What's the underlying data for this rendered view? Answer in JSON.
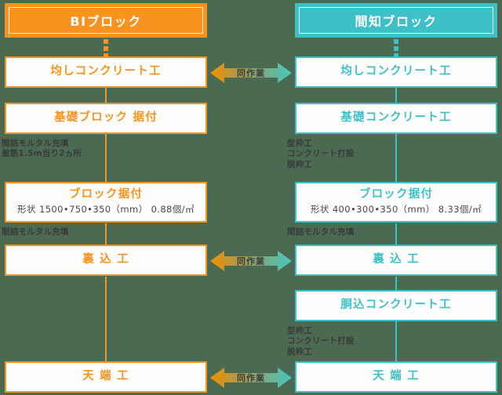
{
  "diagram": {
    "type": "process-flow-comparison",
    "background_color": "#4a6b52",
    "columns": [
      {
        "id": "left",
        "header": "BIブロック",
        "accent_color": "#f7931e"
      },
      {
        "id": "right",
        "header": "間知ブロック",
        "accent_color": "#3ec0c9"
      }
    ],
    "left_steps": [
      {
        "title": "均しコンクリート工",
        "sub": ""
      },
      {
        "title": "基礎ブロック 据付",
        "sub": ""
      },
      {
        "title": "ブロック据付",
        "sub": "形状 1500•750•350（mm） 0.88個/㎡"
      },
      {
        "title": "裏 込 工",
        "sub": ""
      },
      {
        "title": "天 端 工",
        "sub": ""
      }
    ],
    "right_steps": [
      {
        "title": "均しコンクリート工",
        "sub": ""
      },
      {
        "title": "基礎コンクリート工",
        "sub": ""
      },
      {
        "title": "ブロック据付",
        "sub": "形状 400•300•350（mm） 8.33個/㎡"
      },
      {
        "title": "裏 込 工",
        "sub": ""
      },
      {
        "title": "胴込コンクリート工",
        "sub": ""
      },
      {
        "title": "天 端 工",
        "sub": ""
      }
    ],
    "left_notes": [
      {
        "id": "left-note-1",
        "lines": [
          "間詰モルタル充填",
          "差筋1.5m当り2ヵ所"
        ]
      },
      {
        "id": "left-note-2",
        "lines": [
          "間詰モルタル充填"
        ]
      }
    ],
    "right_notes": [
      {
        "id": "right-note-1",
        "lines": [
          "型枠工",
          "コンクリート打設",
          "脱枠工"
        ]
      },
      {
        "id": "right-note-2",
        "lines": [
          "間詰モルタル充填"
        ]
      },
      {
        "id": "right-note-3",
        "lines": [
          "型枠工",
          "コンクリート打設",
          "脱枠工"
        ]
      }
    ],
    "link_arrows": [
      {
        "id": "arrow-1",
        "label": "同作業"
      },
      {
        "id": "arrow-2",
        "label": "同作業"
      },
      {
        "id": "arrow-3",
        "label": "同作業"
      }
    ]
  }
}
